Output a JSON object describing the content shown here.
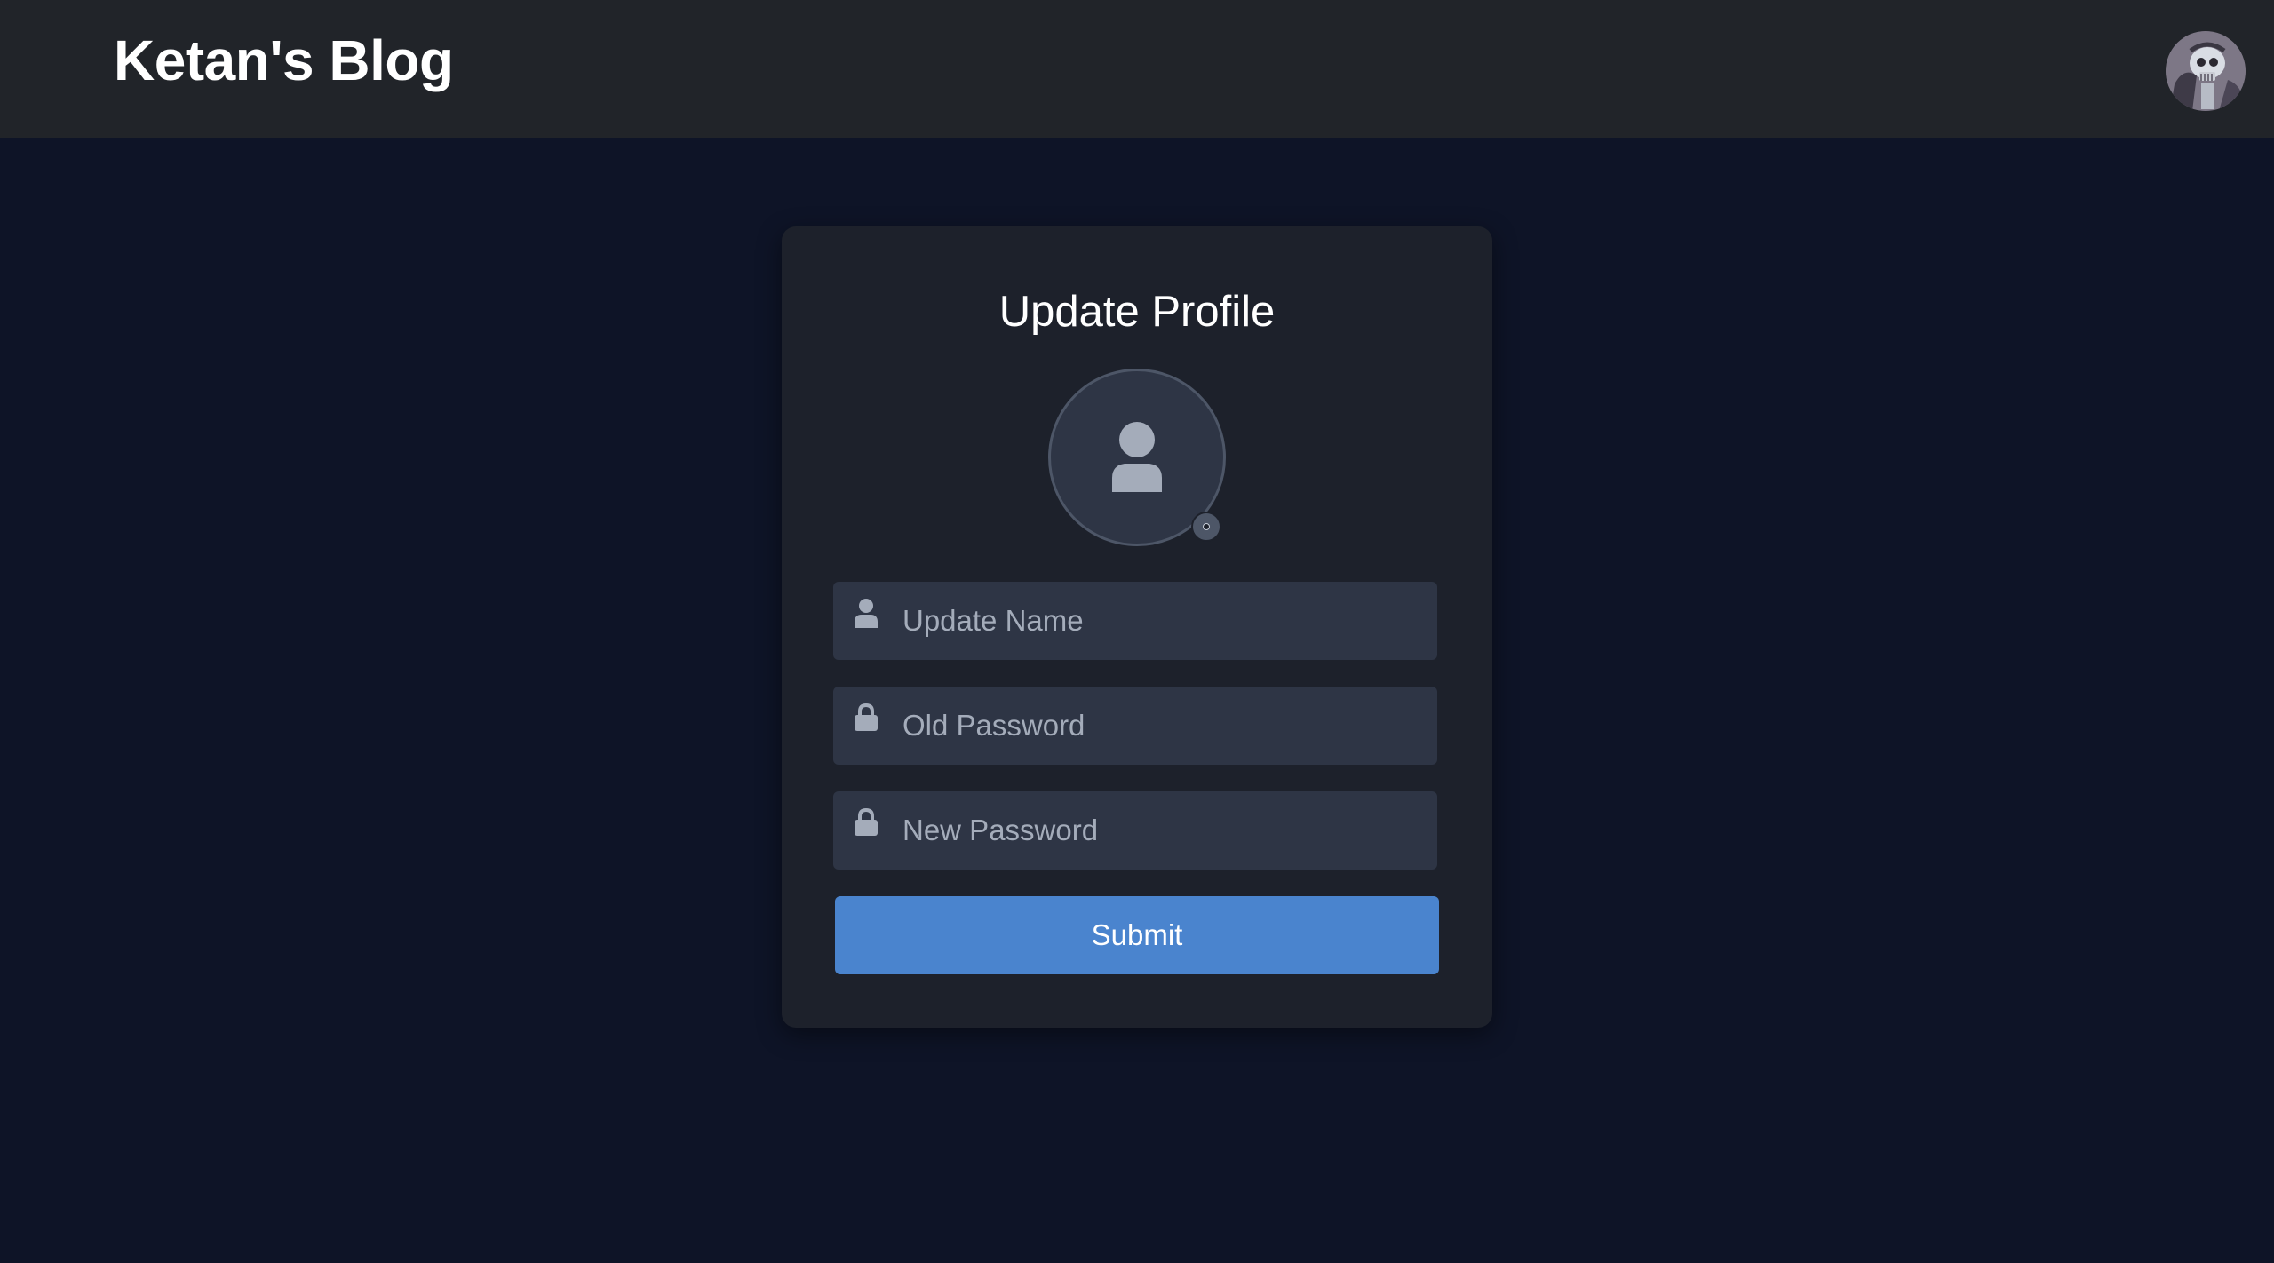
{
  "header": {
    "brand": "Ketan's Blog",
    "avatar_icon": "user-avatar-skull-illustration"
  },
  "profile_form": {
    "title": "Update Profile",
    "profile_picture_icon": "user-icon",
    "edit_picture_icon": "camera-edit-icon",
    "fields": [
      {
        "icon": "user-icon",
        "placeholder": "Update Name",
        "value": ""
      },
      {
        "icon": "lock-icon",
        "placeholder": "Old Password",
        "value": ""
      },
      {
        "icon": "lock-icon",
        "placeholder": "New Password",
        "value": ""
      }
    ],
    "submit_label": "Submit"
  },
  "colors": {
    "page_background": "#0e1427",
    "header_background": "#212429",
    "card_background": "#1d212b",
    "input_background": "#2e3545",
    "icon_color": "#a4acba",
    "accent": "#4a84ce",
    "text": "#ffffff"
  }
}
